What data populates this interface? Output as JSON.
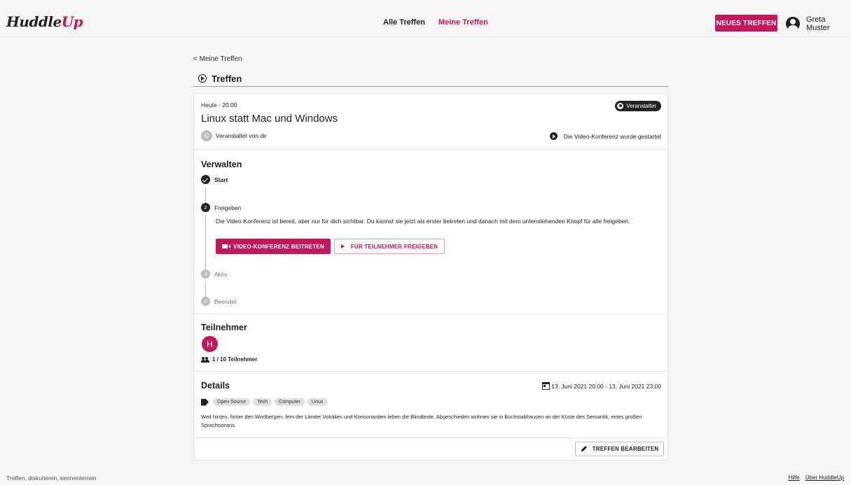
{
  "brand": {
    "logo_main": "Huddle",
    "logo_accent": "Up",
    "accent_color": "#c2185b"
  },
  "nav": {
    "all": "Alle Treffen",
    "mine": "Meine Treffen"
  },
  "header": {
    "new_button": "NEUES TREFFEN",
    "user_name": "Greta Muster"
  },
  "breadcrumb": "< Meine Treffen",
  "section_title": "Treffen",
  "meeting": {
    "date": "Heute · 20:00",
    "role_badge": "Veranstalter",
    "title": "Linux statt Mac und Windows",
    "host_initial": "G",
    "host_text": "Veranstaltet von dir",
    "video_status": "Die Video-Konferenz wurde gestartet"
  },
  "manage": {
    "heading": "Verwalten",
    "steps": [
      {
        "number": "",
        "label": "Start",
        "state": "done"
      },
      {
        "number": "2",
        "label": "Freigeben",
        "state": "active"
      },
      {
        "number": "3",
        "label": "Aktiv",
        "state": "pending"
      },
      {
        "number": "4",
        "label": "Beendet",
        "state": "pending"
      }
    ],
    "active_text": "Die Video-Konferenz ist bereit, aber nur für dich sichtbar. Du kannst sie jetzt als erster betreten und danach mit dem untenstehenden Knopf für alle freigeben.",
    "join_button": "VIDEO-KONFERENZ BEITRETEN",
    "share_button": "FÜR TEILNEHMER FREIGEBEN"
  },
  "participants": {
    "heading": "Teilnehmer",
    "avatar_initial": "H",
    "count_text": "1 / 10 Teilnehmer"
  },
  "details": {
    "heading": "Details",
    "date_range": "13. Juni 2021 20:00 - 13. Juni 2021 23:00",
    "tags": [
      "Open Source",
      "Tech",
      "Computer",
      "Linux"
    ],
    "description": "Weit hinten, hinter den Wortbergen, fern der Länder Vokalien und Konsonantien leben die Blindtexte. Abgeschieden wohnen sie in Buchstabhausen an der Küste des Semantik, eines großen Sprachozeans."
  },
  "edit_button": "TREFFEN BEARBEITEN",
  "footer": {
    "tagline": "Treffen, diskutieren, kennenlernen",
    "help": "Hilfe",
    "about": "Über HuddleUp"
  }
}
